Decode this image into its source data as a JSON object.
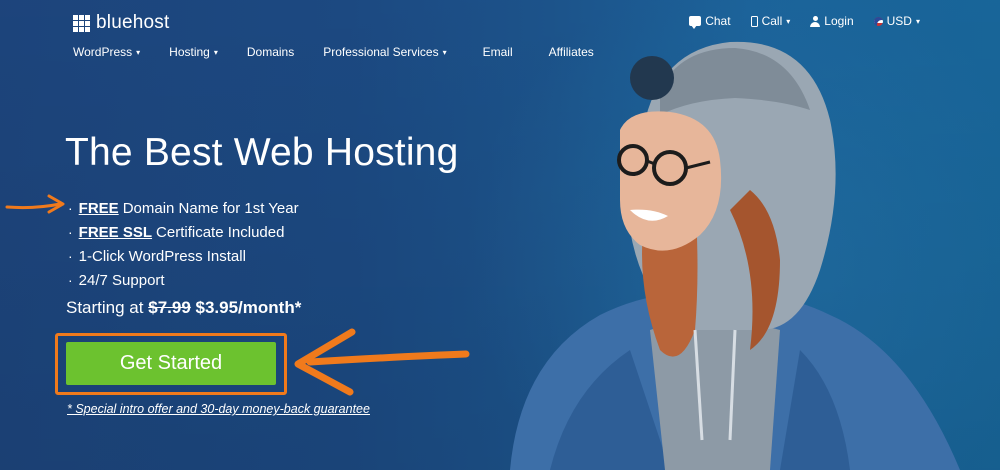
{
  "brand": {
    "name": "bluehost"
  },
  "top_utilities": [
    {
      "label": "Chat",
      "icon": "chat-icon",
      "dropdown": false
    },
    {
      "label": "Call",
      "icon": "phone-icon",
      "dropdown": true
    },
    {
      "label": "Login",
      "icon": "user-icon",
      "dropdown": false
    },
    {
      "label": "USD",
      "icon": "us-flag-icon",
      "dropdown": true
    }
  ],
  "nav": [
    {
      "label": "WordPress",
      "dropdown": true
    },
    {
      "label": "Hosting",
      "dropdown": true
    },
    {
      "label": "Domains",
      "dropdown": false
    },
    {
      "label": "Professional Services",
      "dropdown": true
    },
    {
      "label": "Email",
      "dropdown": false
    },
    {
      "label": "Affiliates",
      "dropdown": false
    }
  ],
  "hero": {
    "headline": "The Best Web Hosting",
    "features": [
      {
        "emphasis": "FREE",
        "text": "Domain Name for 1st Year"
      },
      {
        "emphasis": "FREE SSL",
        "text": "Certificate Included"
      },
      {
        "emphasis": "",
        "text": "1-Click WordPress Install"
      },
      {
        "emphasis": "",
        "text": "24/7 Support"
      }
    ],
    "pricing": {
      "prefix": "Starting at",
      "old_price": "$7.99",
      "new_price": "$3.95/month*"
    },
    "cta_label": "Get Started",
    "offer_note": "* Special intro offer and 30-day money-back guarantee"
  },
  "colors": {
    "cta_green": "#6cc22f",
    "annotation_orange": "#f07a1c",
    "background_blue": "#1f4f8e"
  }
}
